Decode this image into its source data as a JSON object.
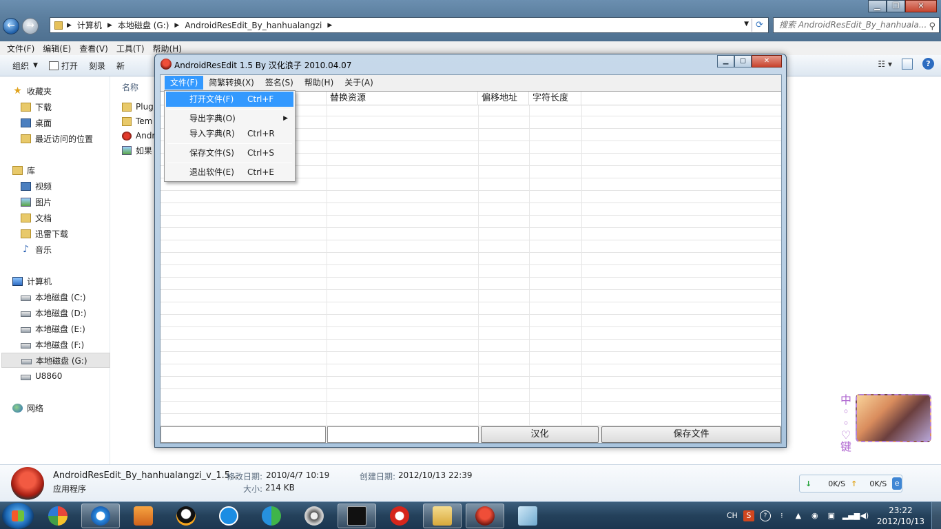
{
  "explorer": {
    "address": {
      "segments": [
        "计算机",
        "本地磁盘 (G:)",
        "AndroidResEdit_By_hanhualangzi"
      ]
    },
    "search_placeholder": "搜索 AndroidResEdit_By_hanhuala...",
    "menu": [
      "文件(F)",
      "编辑(E)",
      "查看(V)",
      "工具(T)",
      "帮助(H)"
    ],
    "toolbar": {
      "organize": "组织",
      "open": "打开",
      "burn": "刻录",
      "new_folder": "新"
    },
    "nav": {
      "favorites": {
        "title": "收藏夹",
        "items": [
          "下载",
          "桌面",
          "最近访问的位置"
        ]
      },
      "libraries": {
        "title": "库",
        "items": [
          "视频",
          "图片",
          "文档",
          "迅雷下载",
          "音乐"
        ]
      },
      "computer": {
        "title": "计算机",
        "items": [
          "本地磁盘 (C:)",
          "本地磁盘 (D:)",
          "本地磁盘 (E:)",
          "本地磁盘 (F:)",
          "本地磁盘 (G:)",
          "U8860"
        ]
      },
      "network": {
        "title": "网络"
      }
    },
    "content": {
      "column_name": "名称",
      "files": [
        "Plug",
        "Tem",
        "Andr",
        "如果"
      ]
    },
    "details": {
      "filename": "AndroidResEdit_By_hanhualangzi_v_1.5...",
      "type": "应用程序",
      "modified_label": "修改日期:",
      "modified": "2010/4/7 10:19",
      "created_label": "创建日期:",
      "created": "2012/10/13 22:39",
      "size_label": "大小:",
      "size": "214 KB"
    },
    "netmon": {
      "down": "0K/S",
      "up": "0K/S"
    }
  },
  "widget": {
    "chars": [
      "中",
      "◦",
      "◦",
      "♡",
      "键"
    ]
  },
  "dialog": {
    "title": "AndroidResEdit 1.5 By 汉化浪子 2010.04.07",
    "menu": [
      "文件(F)",
      "简繁转换(X)",
      "签名(S)",
      "帮助(H)",
      "关于(A)"
    ],
    "columns": [
      "替换资源",
      "偏移地址",
      "字符长度"
    ],
    "buttons": {
      "localize": "汉化",
      "save": "保存文件"
    },
    "file_menu": [
      {
        "label": "打开文件(F)",
        "shortcut": "Ctrl+F"
      },
      {
        "label": "导出字典(O)",
        "shortcut": ""
      },
      {
        "label": "导入字典(R)",
        "shortcut": "Ctrl+R"
      },
      {
        "label": "保存文件(S)",
        "shortcut": "Ctrl+S"
      },
      {
        "label": "退出软件(E)",
        "shortcut": "Ctrl+E"
      }
    ]
  },
  "taskbar": {
    "tray": {
      "lang": "CH",
      "time": "23:22",
      "date": "2012/10/13"
    }
  }
}
